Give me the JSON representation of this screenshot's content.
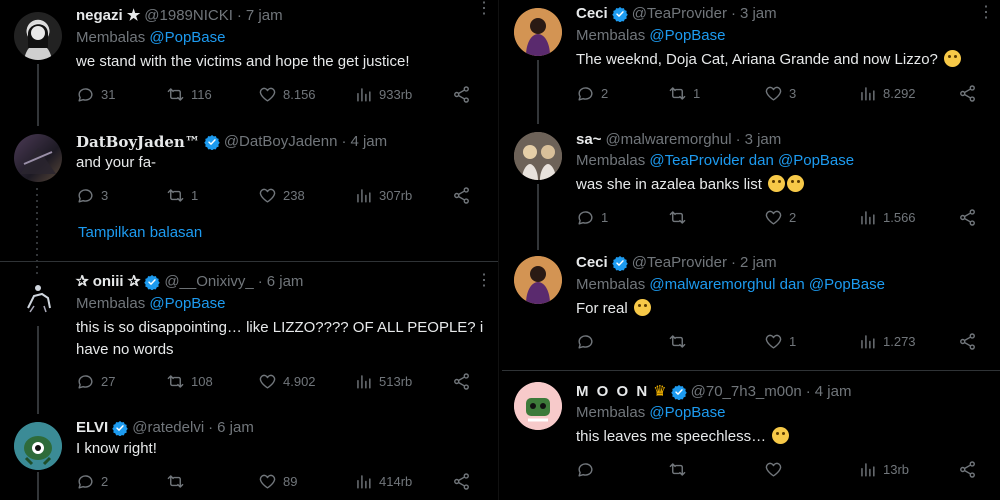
{
  "left": {
    "tweets": [
      {
        "name": "negazi ★",
        "handle": "@1989NICKI",
        "time": "7 jam",
        "replying_prefix": "Membalas",
        "replying_to": "@PopBase",
        "text": "we stand with the victims and hope the get justice!",
        "replies": "31",
        "retweets": "116",
        "likes": "8.156",
        "views": "933rb"
      },
      {
        "name": "DatBoyJaden™",
        "handle": "@DatBoyJadenn",
        "time": "4 jam",
        "text": "and your fa-",
        "replies": "3",
        "retweets": "1",
        "likes": "238",
        "views": "307rb",
        "show_replies": "Tampilkan balasan"
      },
      {
        "name": "✰ oniii ✰",
        "handle": "@__Onixivy_",
        "time": "6 jam",
        "replying_prefix": "Membalas",
        "replying_to": "@PopBase",
        "text": "this is so disappointing… like LIZZO???? OF ALL PEOPLE? i have no words",
        "replies": "27",
        "retweets": "108",
        "likes": "4.902",
        "views": "513rb"
      },
      {
        "name": "ELVI",
        "handle": "@ratedelvi",
        "time": "6 jam",
        "text": "I know right!",
        "replies": "2",
        "retweets": "",
        "likes": "89",
        "views": "414rb"
      }
    ]
  },
  "right": {
    "tweets": [
      {
        "name": "Ceci",
        "handle": "@TeaProvider",
        "time": "3 jam",
        "replying_prefix": "Membalas",
        "replying_to": "@PopBase",
        "text": "The weeknd, Doja Cat, Ariana Grande and now Lizzo?",
        "replies": "2",
        "retweets": "1",
        "likes": "3",
        "views": "8.292"
      },
      {
        "name": "sa~",
        "handle": "@malwaremorghul",
        "time": "3 jam",
        "replying_prefix": "Membalas",
        "replying_to": "@TeaProvider dan @PopBase",
        "text": "was she in azalea banks list",
        "replies": "1",
        "retweets": "",
        "likes": "2",
        "views": "1.566"
      },
      {
        "name": "Ceci",
        "handle": "@TeaProvider",
        "time": "2 jam",
        "replying_prefix": "Membalas",
        "replying_to": "@malwaremorghul dan @PopBase",
        "text": "For real",
        "replies": "",
        "retweets": "",
        "likes": "1",
        "views": "1.273"
      },
      {
        "name": "M O O N",
        "handle": "@70_7h3_m00n",
        "time": "4 jam",
        "replying_prefix": "Membalas",
        "replying_to": "@PopBase",
        "text": "this leaves me speechless…",
        "replies": "",
        "retweets": "",
        "likes": "",
        "views": "13rb"
      }
    ]
  },
  "colors": {
    "background": "#000000",
    "text": "#e7e9ea",
    "muted": "#71767b",
    "link": "#1d9bf0",
    "verified": "#1d9bf0"
  }
}
